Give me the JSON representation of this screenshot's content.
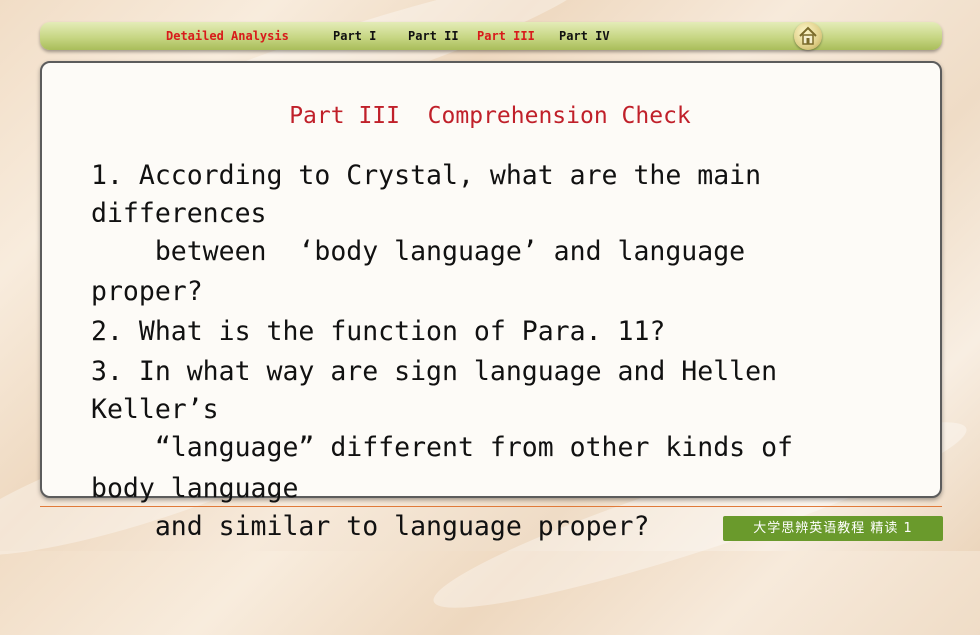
{
  "nav": {
    "detailed": "Detailed Analysis",
    "part1": "Part I",
    "part2": "Part II",
    "part3": "Part III",
    "part4": "Part IV",
    "active_color": "#d81b1b"
  },
  "slide": {
    "title": "Part III  Comprehension Check",
    "lines": [
      "1. According to Crystal, what are the main",
      "differences",
      "    between  ‘body language’ and language",
      "proper?",
      "2. What is the function of Para. 11?",
      "3. In what way are sign language and Hellen",
      "Keller’s",
      "    “language” different from other kinds of",
      "body language",
      "    and similar to language proper?"
    ]
  },
  "footer": {
    "badge": "大学思辨英语教程 精读 1",
    "badge_color": "#6a9a2c"
  }
}
